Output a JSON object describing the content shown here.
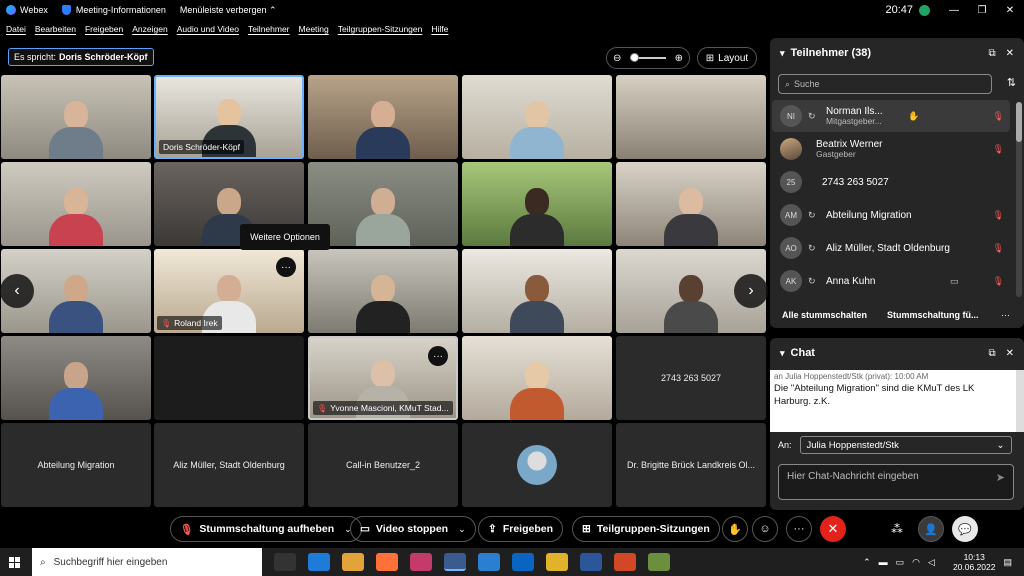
{
  "titlebar": {
    "app_name": "Webex",
    "meeting_info": "Meeting-Informationen",
    "hide_menu": "Menüleiste verbergen",
    "time": "20:47"
  },
  "menu": [
    "Datei",
    "Bearbeiten",
    "Freigeben",
    "Anzeigen",
    "Audio und Video",
    "Teilnehmer",
    "Meeting",
    "Teilgruppen-Sitzungen",
    "Hilfe"
  ],
  "speaker": {
    "prefix": "Es spricht:",
    "name": "Doris Schröder-Köpf"
  },
  "layout_label": "Layout",
  "tooltip": "Weitere Optionen",
  "tiles": {
    "doris": "Doris Schröder-Köpf",
    "roland": "Roland Irek",
    "yvonne": "Yvonne Mascioni, KMuT Stad...",
    "phone": "2743 263 5027",
    "migration": "Abteilung Migration",
    "aliz": "Aliz Müller, Stadt Oldenburg",
    "callin": "Call-in Benutzer_2",
    "brigitte": "Dr. Brigitte Brück Landkreis Ol..."
  },
  "participants": {
    "title": "Teilnehmer (38)",
    "search_placeholder": "Suche",
    "rows": [
      {
        "initials": "NI",
        "name": "Norman Ils...",
        "role": "Mitgastgeber..."
      },
      {
        "initials": "",
        "name": "Beatrix Werner",
        "role": "Gastgeber"
      },
      {
        "initials": "25",
        "name": "2743 263 5027",
        "role": ""
      },
      {
        "initials": "AM",
        "name": "Abteilung Migration",
        "role": ""
      },
      {
        "initials": "AO",
        "name": "Aliz Müller, Stadt Oldenburg",
        "role": ""
      },
      {
        "initials": "AK",
        "name": "Anna Kuhn",
        "role": ""
      }
    ],
    "mute_all": "Alle stummschalten",
    "mute_on_entry": "Stummschaltung fü..."
  },
  "chat": {
    "title": "Chat",
    "meta": "an Julia Hoppenstedt/Stk (privat):     10:00 AM",
    "message": "Die \"Abteilung Migration\" sind die KMuT des LK Harburg. z.K.",
    "to_label": "An:",
    "to_value": "Julia Hoppenstedt/Stk",
    "input_placeholder": "Hier Chat-Nachricht eingeben"
  },
  "controls": {
    "unmute": "Stummschaltung aufheben",
    "stop_video": "Video stoppen",
    "share": "Freigeben",
    "breakout": "Teilgruppen-Sitzungen"
  },
  "taskbar": {
    "search_placeholder": "Suchbegriff hier eingeben",
    "time": "10:13",
    "date": "20.06.2022"
  }
}
